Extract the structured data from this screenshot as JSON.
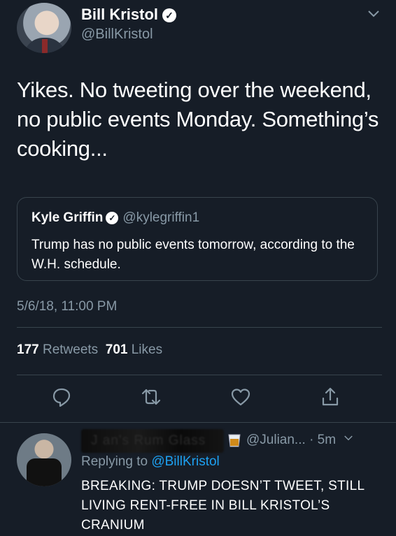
{
  "tweet": {
    "author_name": "Bill Kristol",
    "author_handle": "@BillKristol",
    "text": "Yikes. No tweeting over the weekend, no public events Monday. Something’s cooking...",
    "timestamp": "5/6/18, 11:00 PM",
    "retweets_count": "177",
    "retweets_label": "Retweets",
    "likes_count": "701",
    "likes_label": "Likes"
  },
  "quoted_tweet": {
    "author_name": "Kyle Griffin",
    "author_handle": "@kylegriffin1",
    "text": "Trump has no public events tomorrow, according to the W.H. schedule."
  },
  "actions": [
    {
      "icon": "reply-icon"
    },
    {
      "icon": "retweet-icon"
    },
    {
      "icon": "like-icon"
    },
    {
      "icon": "share-icon"
    }
  ],
  "reply": {
    "author_name_obscured": "J   an's Rum Glass",
    "author_handle": "@Julian...",
    "time": "· 5m",
    "replying_prefix": "Replying to",
    "replying_to": "@BillKristol",
    "text": "BREAKING: TRUMP DOESN’T TWEET, STILL LIVING RENT-FREE IN BILL KRISTOL’S CRANIUM"
  },
  "colors": {
    "background": "#161d27",
    "secondary_text": "#8899a6",
    "link": "#1da1f2",
    "divider": "#38444d"
  }
}
